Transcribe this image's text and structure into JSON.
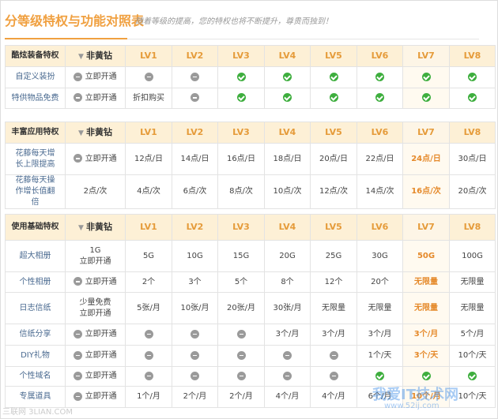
{
  "header": {
    "title": "分等级特权与功能对照表",
    "subtitle": "随着等级的提高，您的特权也将不断提升，尊贵而独到！"
  },
  "columns": {
    "non_yellow": "非黄钻",
    "levels": [
      "LV1",
      "LV2",
      "LV3",
      "LV4",
      "LV5",
      "LV6",
      "LV7",
      "LV8"
    ]
  },
  "sections": [
    {
      "title": "酷炫装备特权",
      "rows": [
        {
          "label": "自定义装扮",
          "cells": [
            {
              "t": "open",
              "v": "立即开通"
            },
            {
              "t": "minus"
            },
            {
              "t": "minus"
            },
            {
              "t": "check"
            },
            {
              "t": "check"
            },
            {
              "t": "check"
            },
            {
              "t": "check"
            },
            {
              "t": "check"
            },
            {
              "t": "check"
            }
          ]
        },
        {
          "label": "特供物品免费",
          "cells": [
            {
              "t": "open",
              "v": "立即开通"
            },
            {
              "t": "text",
              "v": "折扣购买"
            },
            {
              "t": "minus"
            },
            {
              "t": "check"
            },
            {
              "t": "check"
            },
            {
              "t": "check"
            },
            {
              "t": "check"
            },
            {
              "t": "check"
            },
            {
              "t": "check"
            }
          ]
        }
      ]
    },
    {
      "title": "丰富应用特权",
      "rows": [
        {
          "label": "花藤每天增长上限提高",
          "cells": [
            {
              "t": "open",
              "v": "立即开通"
            },
            {
              "t": "text",
              "v": "12点/日"
            },
            {
              "t": "text",
              "v": "14点/日"
            },
            {
              "t": "text",
              "v": "16点/日"
            },
            {
              "t": "text",
              "v": "18点/日"
            },
            {
              "t": "text",
              "v": "20点/日"
            },
            {
              "t": "text",
              "v": "22点/日"
            },
            {
              "t": "text",
              "v": "24点/日"
            },
            {
              "t": "text",
              "v": "30点/日"
            }
          ]
        },
        {
          "label": "花藤每天操作增长值翻倍",
          "cells": [
            {
              "t": "text",
              "v": "2点/次"
            },
            {
              "t": "text",
              "v": "4点/次"
            },
            {
              "t": "text",
              "v": "6点/次"
            },
            {
              "t": "text",
              "v": "8点/次"
            },
            {
              "t": "text",
              "v": "10点/次"
            },
            {
              "t": "text",
              "v": "12点/次"
            },
            {
              "t": "text",
              "v": "14点/次"
            },
            {
              "t": "text",
              "v": "16点/次"
            },
            {
              "t": "text",
              "v": "20点/次"
            }
          ]
        }
      ]
    },
    {
      "title": "使用基础特权",
      "rows": [
        {
          "label": "超大相册",
          "cells": [
            {
              "t": "text2",
              "v": "1G",
              "v2": "立即开通"
            },
            {
              "t": "text",
              "v": "5G"
            },
            {
              "t": "text",
              "v": "10G"
            },
            {
              "t": "text",
              "v": "15G"
            },
            {
              "t": "text",
              "v": "20G"
            },
            {
              "t": "text",
              "v": "25G"
            },
            {
              "t": "text",
              "v": "30G"
            },
            {
              "t": "text",
              "v": "50G"
            },
            {
              "t": "text",
              "v": "100G"
            }
          ]
        },
        {
          "label": "个性相册",
          "cells": [
            {
              "t": "open",
              "v": "立即开通"
            },
            {
              "t": "text",
              "v": "2个"
            },
            {
              "t": "text",
              "v": "3个"
            },
            {
              "t": "text",
              "v": "5个"
            },
            {
              "t": "text",
              "v": "8个"
            },
            {
              "t": "text",
              "v": "12个"
            },
            {
              "t": "text",
              "v": "20个"
            },
            {
              "t": "text",
              "v": "无限量"
            },
            {
              "t": "text",
              "v": "无限量"
            }
          ]
        },
        {
          "label": "日志信纸",
          "cells": [
            {
              "t": "text2",
              "v": "少量免费",
              "v2": "立即开通"
            },
            {
              "t": "text",
              "v": "5张/月"
            },
            {
              "t": "text",
              "v": "10张/月"
            },
            {
              "t": "text",
              "v": "20张/月"
            },
            {
              "t": "text",
              "v": "30张/月"
            },
            {
              "t": "text",
              "v": "无限量"
            },
            {
              "t": "text",
              "v": "无限量"
            },
            {
              "t": "text",
              "v": "无限量"
            },
            {
              "t": "text",
              "v": "无限量"
            }
          ]
        },
        {
          "label": "信纸分享",
          "cells": [
            {
              "t": "open",
              "v": "立即开通"
            },
            {
              "t": "minus"
            },
            {
              "t": "minus"
            },
            {
              "t": "minus"
            },
            {
              "t": "text",
              "v": "3个/月"
            },
            {
              "t": "text",
              "v": "3个/月"
            },
            {
              "t": "text",
              "v": "3个/月"
            },
            {
              "t": "text",
              "v": "3个/月"
            },
            {
              "t": "text",
              "v": "5个/月"
            }
          ]
        },
        {
          "label": "DIY礼物",
          "cells": [
            {
              "t": "open",
              "v": "立即开通"
            },
            {
              "t": "minus"
            },
            {
              "t": "minus"
            },
            {
              "t": "minus"
            },
            {
              "t": "minus"
            },
            {
              "t": "minus"
            },
            {
              "t": "text",
              "v": "1个/天"
            },
            {
              "t": "text",
              "v": "3个/天"
            },
            {
              "t": "text",
              "v": "10个/天"
            }
          ]
        },
        {
          "label": "个性域名",
          "cells": [
            {
              "t": "open",
              "v": "立即开通"
            },
            {
              "t": "minus"
            },
            {
              "t": "minus"
            },
            {
              "t": "minus"
            },
            {
              "t": "minus"
            },
            {
              "t": "minus"
            },
            {
              "t": "check"
            },
            {
              "t": "check"
            },
            {
              "t": "check"
            }
          ]
        },
        {
          "label": "专属道具",
          "cells": [
            {
              "t": "open",
              "v": "立即开通"
            },
            {
              "t": "text",
              "v": "1个/月"
            },
            {
              "t": "text",
              "v": "2个/月"
            },
            {
              "t": "text",
              "v": "2个/月"
            },
            {
              "t": "text",
              "v": "4个/月"
            },
            {
              "t": "text",
              "v": "4个/月"
            },
            {
              "t": "text",
              "v": "6个/月"
            },
            {
              "t": "text",
              "v": "10个/月"
            },
            {
              "t": "text",
              "v": "10个/天"
            }
          ]
        }
      ]
    }
  ],
  "watermarks": {
    "left": "三联网 3LIAN.COM",
    "right": "我爱IT技术网",
    "right_url": "www.52ij.com"
  }
}
